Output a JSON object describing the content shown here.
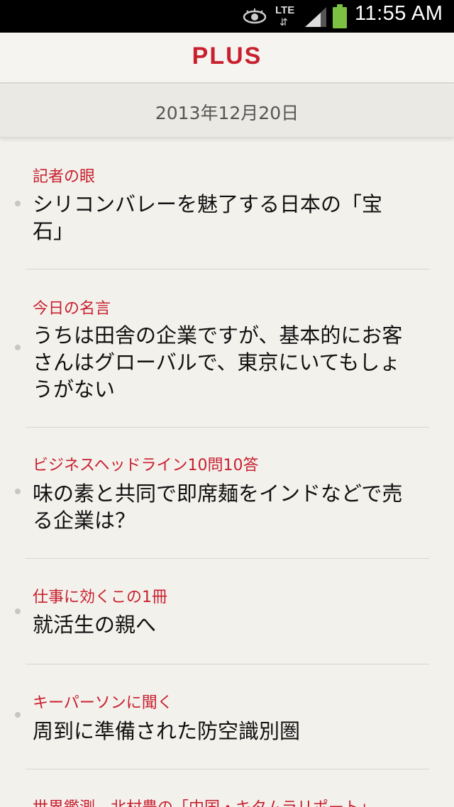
{
  "status_bar": {
    "network": "LTE",
    "time": "11:55 AM",
    "icons": [
      "eye-icon",
      "lte-icon",
      "signal-icon",
      "battery-icon"
    ]
  },
  "app_bar": {
    "title": "PLUS"
  },
  "date": "2013年12月20日",
  "colors": {
    "accent": "#c8202f",
    "background": "#f3f1ec"
  },
  "articles": [
    {
      "category": "記者の眼",
      "headline_lines": [
        "シリコンバレーを魅了する日本の「宝",
        "石」"
      ]
    },
    {
      "category": "今日の名言",
      "headline_lines": [
        "うちは田舎の企業ですが、基本的にお客",
        "さんはグローバルで、東京にいてもしょ",
        "うがない"
      ]
    },
    {
      "category": "ビジネスヘッドライン10問10答",
      "headline_lines": [
        "味の素と共同で即席麺をインドなどで売",
        "る企業は？"
      ]
    },
    {
      "category": "仕事に効くこの1冊",
      "headline_lines": [
        "就活生の親へ"
      ]
    },
    {
      "category": "キーパーソンに聞く",
      "headline_lines": [
        "周到に準備された防空識別圏"
      ]
    },
    {
      "category": "世界鑑測　北村豊の「中国・キタムラリポート」",
      "headline_lines": []
    }
  ]
}
